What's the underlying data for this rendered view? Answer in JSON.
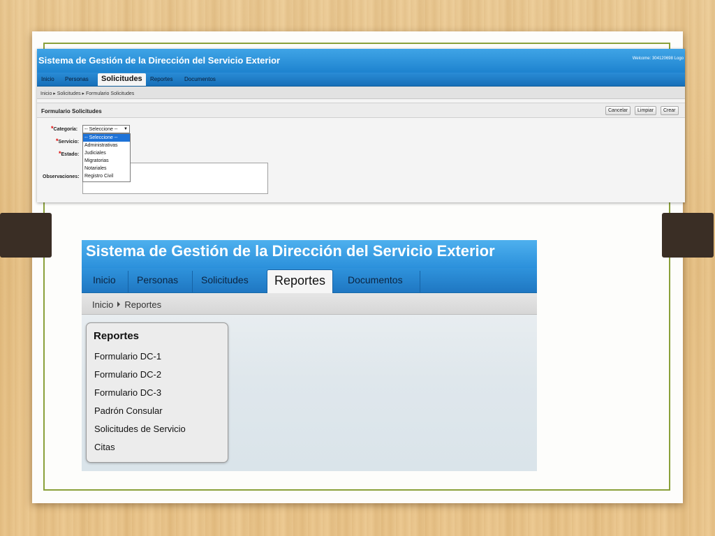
{
  "app1": {
    "title": "Sistema de Gestión de la Dirección del Servicio Exterior",
    "welcome": "Welcome: 304120698 Logo",
    "tabs": [
      "Inicio",
      "Personas",
      "Solicitudes",
      "Reportes",
      "Documentos"
    ],
    "active_tab": "Solicitudes",
    "breadcrumb": "Inicio ▸ Solicitudes ▸ Formulario Solicitudes",
    "panel_title": "Formulario Solicitudes",
    "buttons": {
      "cancel": "Cancelar",
      "clear": "Limpiar",
      "create": "Crear"
    },
    "fields": {
      "categoria": "Categoría:",
      "servicio": "Servicio:",
      "estado": "Estado:",
      "observaciones": "Observaciones:"
    },
    "required_mark": "*",
    "select_value": "-- Seleccione --",
    "dropdown_options": [
      "-- Seleccione --",
      "Administrativas",
      "Judiciales",
      "Migratorias",
      "Notariales",
      "Registro Civil"
    ]
  },
  "app2": {
    "title": "Sistema de Gestión de la Dirección del Servicio Exterior",
    "tabs": [
      "Inicio",
      "Personas",
      "Solicitudes",
      "Reportes",
      "Documentos"
    ],
    "active_tab": "Reportes",
    "breadcrumb": {
      "home": "Inicio",
      "current": "Reportes"
    },
    "card_title": "Reportes",
    "links": [
      "Formulario DC-1",
      "Formulario DC-2",
      "Formulario DC-3",
      "Padrón Consular",
      "Solicitudes de Servicio",
      "Citas"
    ]
  },
  "colors": {
    "header_blue": "#2b90db",
    "frame_green": "#8aa03a",
    "clip_brown": "#3a2e25"
  }
}
